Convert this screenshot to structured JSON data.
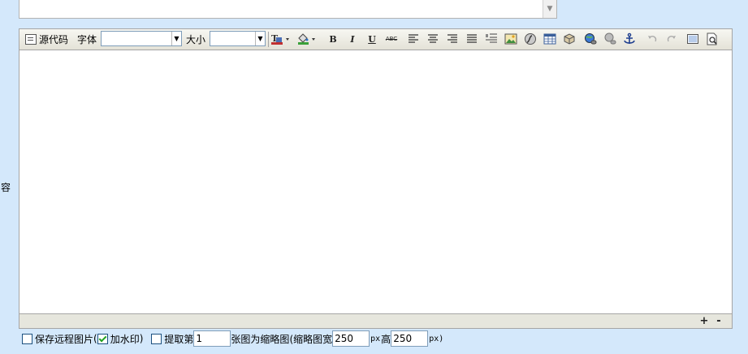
{
  "side_label": "容",
  "toolbar": {
    "source_label": "源代码",
    "font_label": "字体",
    "font_value": "",
    "size_label": "大小",
    "size_value": "",
    "bold_label": "B",
    "italic_label": "I",
    "underline_label": "U",
    "strike_label": "ABC"
  },
  "options": {
    "save_remote_images": {
      "label": "保存远程图片",
      "checked": false
    },
    "paren_open": "(",
    "watermark": {
      "label": "加水印",
      "checked": true
    },
    "paren_close": ")",
    "extract": {
      "label_prefix": "提取第",
      "checked": false
    },
    "image_index": "1",
    "label_middle": "张图为缩略图",
    "thumb_width_label": "(缩略图宽",
    "thumb_width": "250",
    "unit_px_1": "px",
    "thumb_height_label": "高",
    "thumb_height": "250",
    "unit_px_2": "px)"
  },
  "resize": {
    "grow": "+",
    "shrink": "-"
  }
}
